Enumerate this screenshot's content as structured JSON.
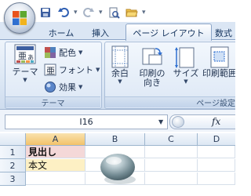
{
  "quick_access": {
    "icons": [
      "save-icon",
      "undo-icon",
      "redo-icon",
      "print-preview-icon",
      "open-folder-icon"
    ],
    "customize_glyph": "▾"
  },
  "tabs": [
    {
      "label": "ホーム",
      "active": false
    },
    {
      "label": "挿入",
      "active": false
    },
    {
      "label": "ページ レイアウト",
      "active": true
    },
    {
      "label": "数式",
      "active": false
    }
  ],
  "ribbon": {
    "theme_group": {
      "label": "テーマ",
      "theme_button": "テーマ",
      "colors": "配色",
      "fonts": "フォント",
      "effects": "効果"
    },
    "page_setup_group": {
      "label": "ページ設定",
      "margins": "余白",
      "orientation_line1": "印刷の",
      "orientation_line2": "向き",
      "size": "サイズ",
      "print_area": "印刷範囲"
    }
  },
  "formula_bar": {
    "name_box": "I16",
    "fx": "fx"
  },
  "sheet": {
    "columns": [
      "A",
      "B",
      "C",
      "D"
    ],
    "selected_column": "A",
    "rows": [
      "1",
      "2",
      "3"
    ],
    "cells": {
      "A1": "見出し",
      "A2": "本文"
    }
  },
  "colors": {
    "accent": "#dbe6f4",
    "a1_fill": "#f4d8d8",
    "a2_fill": "#fdf0c4"
  }
}
